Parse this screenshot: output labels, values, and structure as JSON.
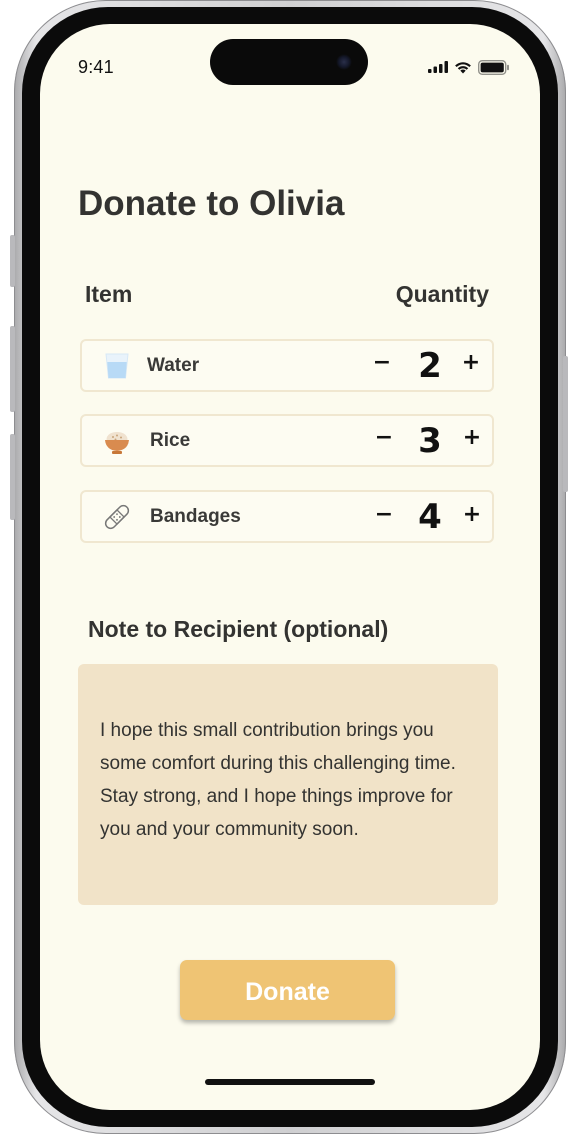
{
  "status_bar": {
    "time": "9:41"
  },
  "page": {
    "title": "Donate to Olivia"
  },
  "table": {
    "item_header": "Item",
    "quantity_header": "Quantity",
    "minus_label": "−",
    "plus_label": "+",
    "items": [
      {
        "name": "Water",
        "quantity": "2",
        "icon": "water-glass-icon"
      },
      {
        "name": "Rice",
        "quantity": "3",
        "icon": "rice-bowl-icon"
      },
      {
        "name": "Bandages",
        "quantity": "4",
        "icon": "bandage-icon"
      }
    ]
  },
  "note": {
    "label": "Note to Recipient (optional)",
    "text": "I hope this small contribution brings you some comfort during this challenging time. Stay strong, and I hope things improve for you and your community soon."
  },
  "donate_button": {
    "label": "Donate"
  },
  "colors": {
    "background": "#fcfbee",
    "accent": "#efc474",
    "note_background": "#f1e3c8",
    "row_border": "#f0e7d0",
    "text": "#333331"
  }
}
